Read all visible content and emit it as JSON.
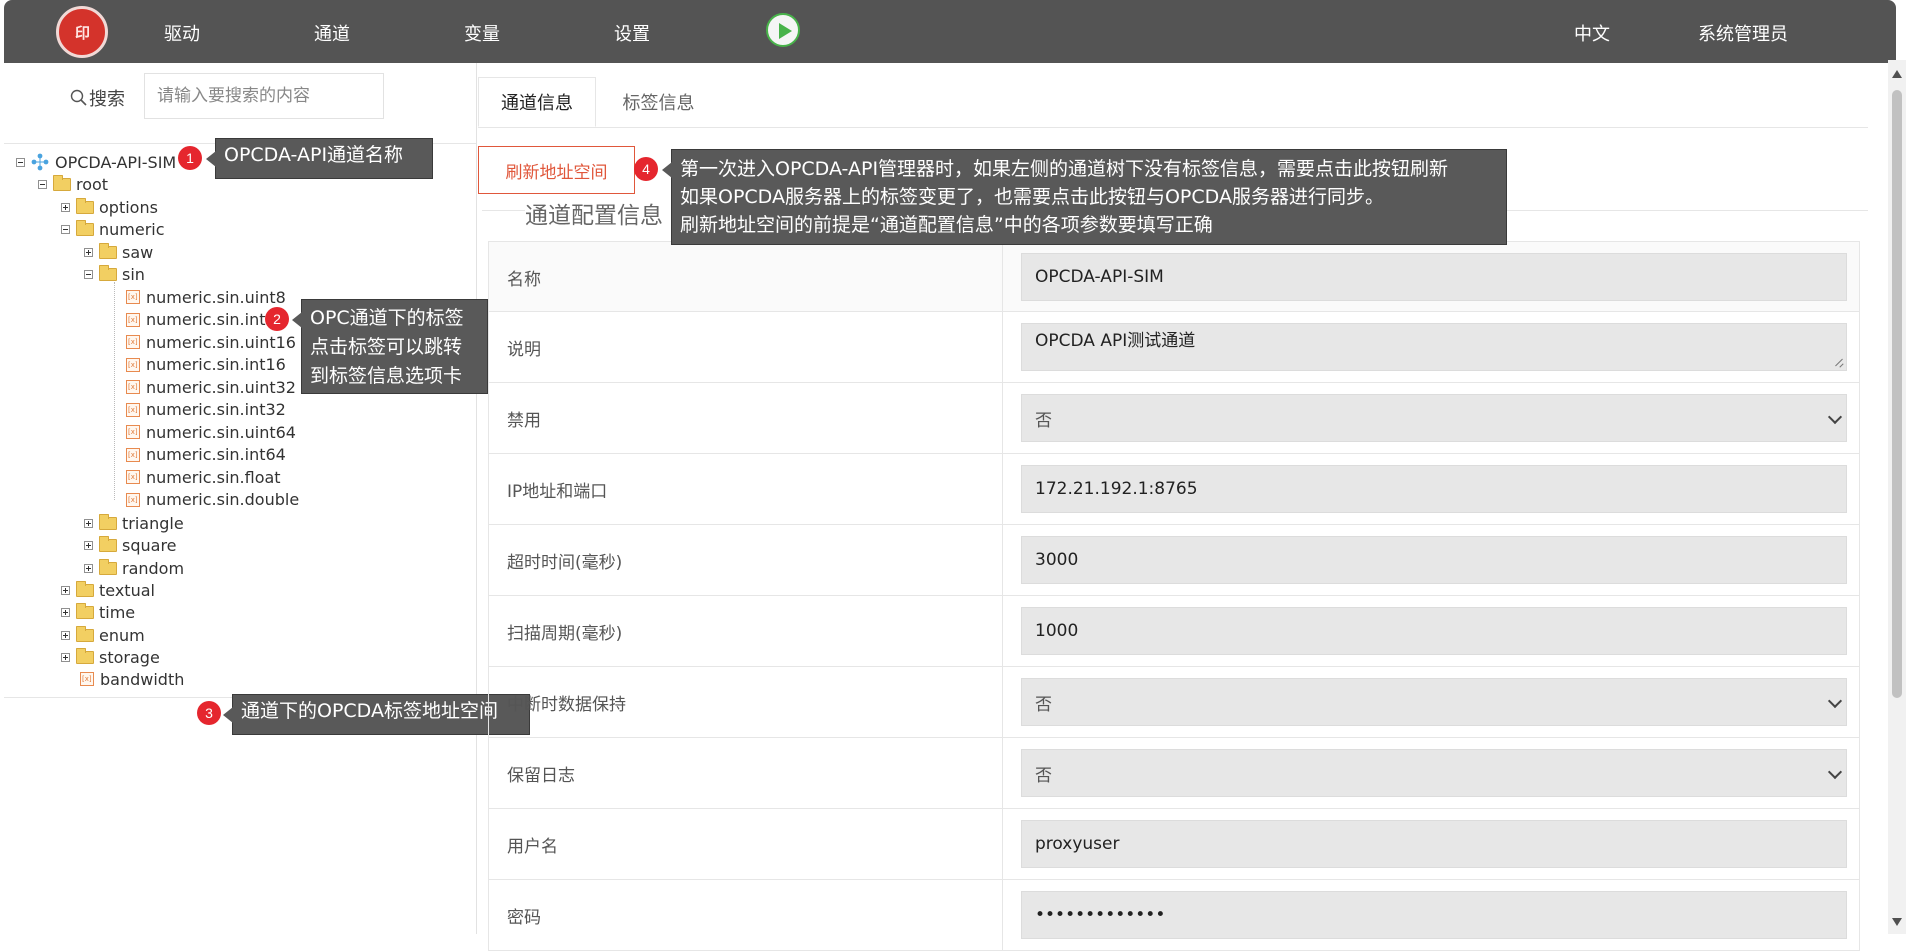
{
  "topbar": {
    "logo_text": "印",
    "nav": [
      "驱动",
      "通道",
      "变量",
      "设置"
    ],
    "language": "中文",
    "user": "系统管理员",
    "play_color": "#48b34a",
    "bar_color": "#545454"
  },
  "search": {
    "label": "搜索",
    "placeholder": "请输入要搜索的内容"
  },
  "tree": {
    "channel": "OPCDA-API-SIM",
    "root": "root",
    "options": "options",
    "numeric": "numeric",
    "saw": "saw",
    "sin": "sin",
    "sin_tags": [
      "numeric.sin.uint8",
      "numeric.sin.int8",
      "numeric.sin.uint16",
      "numeric.sin.int16",
      "numeric.sin.uint32",
      "numeric.sin.int32",
      "numeric.sin.uint64",
      "numeric.sin.int64",
      "numeric.sin.float",
      "numeric.sin.double"
    ],
    "triangle": "triangle",
    "square": "square",
    "random": "random",
    "textual": "textual",
    "time": "time",
    "enum": "enum",
    "storage": "storage",
    "bandwidth": "bandwidth"
  },
  "callouts": {
    "c1": {
      "num": "1",
      "text": "OPCDA-API通道名称"
    },
    "c2": {
      "num": "2",
      "line1": "OPC通道下的标签",
      "line2": "点击标签可以跳转",
      "line3": "到标签信息选项卡"
    },
    "c3": {
      "num": "3",
      "text": "通道下的OPCDA标签地址空间"
    },
    "c4": {
      "num": "4",
      "line1": "第一次进入OPCDA-API管理器时，如果左侧的通道树下没有标签信息，需要点击此按钮刷新",
      "line2": "如果OPCDA服务器上的标签变更了，也需要点击此按钮与OPCDA服务器进行同步。",
      "line3": "刷新地址空间的前提是“通道配置信息”中的各项参数要填写正确"
    },
    "badge_color": "#e5262e"
  },
  "tabs": [
    "通道信息",
    "标签信息"
  ],
  "refresh_button": "刷新地址空间",
  "section_title": "通道配置信息",
  "form": [
    {
      "label": "名称",
      "value": "OPCDA-API-SIM",
      "kind": "input"
    },
    {
      "label": "说明",
      "value": "OPCDA API测试通道",
      "kind": "textarea"
    },
    {
      "label": "禁用",
      "value": "否",
      "kind": "select"
    },
    {
      "label": "IP地址和端口",
      "value": "172.21.192.1:8765",
      "kind": "input"
    },
    {
      "label": "超时时间(毫秒)",
      "value": "3000",
      "kind": "input"
    },
    {
      "label": "扫描周期(毫秒)",
      "value": "1000",
      "kind": "input"
    },
    {
      "label": "中断时数据保持",
      "value": "否",
      "kind": "select"
    },
    {
      "label": "保留日志",
      "value": "否",
      "kind": "select"
    },
    {
      "label": "用户名",
      "value": "proxyuser",
      "kind": "input"
    },
    {
      "label": "密码",
      "value": "•••••••••••••",
      "kind": "password"
    }
  ]
}
